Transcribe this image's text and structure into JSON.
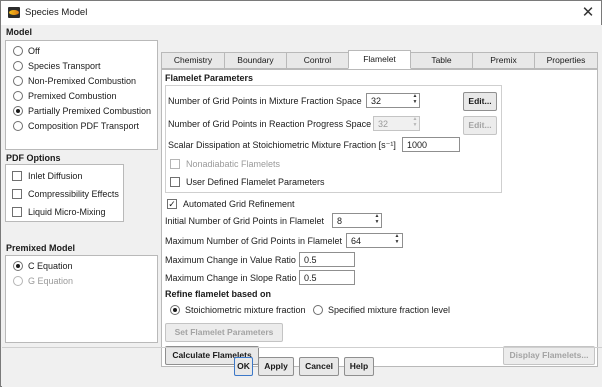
{
  "window": {
    "title": "Species Model",
    "close_glyph": "✕"
  },
  "model": {
    "label": "Model",
    "options": [
      {
        "label": "Off",
        "selected": false
      },
      {
        "label": "Species Transport",
        "selected": false
      },
      {
        "label": "Non-Premixed Combustion",
        "selected": false
      },
      {
        "label": "Premixed Combustion",
        "selected": false
      },
      {
        "label": "Partially Premixed Combustion",
        "selected": true
      },
      {
        "label": "Composition PDF Transport",
        "selected": false
      }
    ]
  },
  "pdf_options": {
    "label": "PDF Options",
    "items": [
      {
        "label": "Inlet Diffusion",
        "checked": false
      },
      {
        "label": "Compressibility Effects",
        "checked": false
      },
      {
        "label": "Liquid Micro-Mixing",
        "checked": false
      }
    ]
  },
  "premixed_model": {
    "label": "Premixed Model",
    "options": [
      {
        "label": "C Equation",
        "selected": true,
        "enabled": true
      },
      {
        "label": "G Equation",
        "selected": false,
        "enabled": false
      }
    ]
  },
  "tabs": [
    {
      "label": "Chemistry",
      "active": false
    },
    {
      "label": "Boundary",
      "active": false
    },
    {
      "label": "Control",
      "active": false
    },
    {
      "label": "Flamelet",
      "active": true
    },
    {
      "label": "Table",
      "active": false
    },
    {
      "label": "Premix",
      "active": false
    },
    {
      "label": "Properties",
      "active": false
    }
  ],
  "flamelet": {
    "params_heading": "Flamelet Parameters",
    "grid_mixture_label": "Number of Grid Points in Mixture Fraction Space",
    "grid_mixture_value": "32",
    "grid_progress_label": "Number of Grid Points in Reaction Progress Space",
    "grid_progress_value": "32",
    "scalar_dissipation_label": "Scalar Dissipation at Stoichiometric Mixture Fraction [s⁻¹]",
    "scalar_dissipation_value": "1000",
    "edit_label": "Edit...",
    "nonadiabatic_label": "Nonadiabatic Flamelets",
    "user_defined_label": "User Defined Flamelet Parameters",
    "auto_refinement_label": "Automated Grid Refinement",
    "auto_refinement_checked": true,
    "initial_points_label": "Initial Number of Grid Points in Flamelet",
    "initial_points_value": "8",
    "max_points_label": "Maximum Number of Grid Points in Flamelet",
    "max_points_value": "64",
    "max_value_ratio_label": "Maximum Change in Value Ratio",
    "max_value_ratio_value": "0.5",
    "max_slope_ratio_label": "Maximum Change in Slope Ratio",
    "max_slope_ratio_value": "0.5",
    "refine_heading": "Refine flamelet based on",
    "refine_options": [
      {
        "label": "Stoichiometric mixture fraction",
        "selected": true
      },
      {
        "label": "Specified mixture fraction level",
        "selected": false
      }
    ],
    "set_params_label": "Set Flamelet Parameters",
    "calculate_label": "Calculate Flamelets",
    "display_label": "Display Flamelets..."
  },
  "footer": {
    "ok": "OK",
    "apply": "Apply",
    "cancel": "Cancel",
    "help": "Help"
  },
  "colors": {
    "accent": "#3c78c8",
    "window_bg": "#f0f0f0"
  }
}
